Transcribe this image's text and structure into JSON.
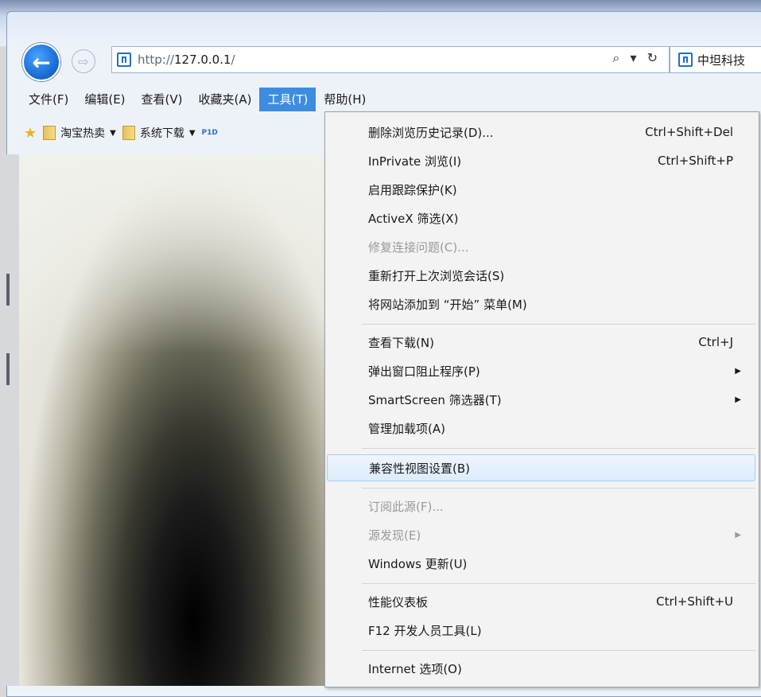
{
  "browser": {
    "address": {
      "url_prefix": "http://",
      "url_host": "127.0.0.1",
      "url_suffix": "/",
      "search_glyphs": "⌕ ▾ ↻"
    },
    "tab": {
      "title": "中坦科技"
    },
    "back_icon": "←",
    "forward_icon": "⇨"
  },
  "menubar": {
    "items": [
      {
        "label": "文件(F)"
      },
      {
        "label": "编辑(E)"
      },
      {
        "label": "查看(V)"
      },
      {
        "label": "收藏夹(A)"
      },
      {
        "label": "工具(T)"
      },
      {
        "label": "帮助(H)"
      }
    ]
  },
  "favorites": {
    "items": [
      {
        "label": "淘宝热卖"
      },
      {
        "label": "系统下载"
      }
    ],
    "pid": "P1D"
  },
  "tools_menu": {
    "items": [
      {
        "label": "删除浏览历史记录(D)...",
        "shortcut": "Ctrl+Shift+Del"
      },
      {
        "label": "InPrivate 浏览(I)",
        "shortcut": "Ctrl+Shift+P"
      },
      {
        "label": "启用跟踪保护(K)",
        "shortcut": ""
      },
      {
        "label": "ActiveX 筛选(X)",
        "shortcut": ""
      },
      {
        "label": "修复连接问题(C)...",
        "shortcut": ""
      },
      {
        "label": "重新打开上次浏览会话(S)",
        "shortcut": ""
      },
      {
        "label": "将网站添加到 “开始” 菜单(M)",
        "shortcut": ""
      },
      {
        "label": "查看下载(N)",
        "shortcut": "Ctrl+J"
      },
      {
        "label": "弹出窗口阻止程序(P)",
        "shortcut": ""
      },
      {
        "label": "SmartScreen 筛选器(T)",
        "shortcut": ""
      },
      {
        "label": "管理加载项(A)",
        "shortcut": ""
      },
      {
        "label": "兼容性视图设置(B)",
        "shortcut": ""
      },
      {
        "label": "订阅此源(F)...",
        "shortcut": ""
      },
      {
        "label": "源发现(E)",
        "shortcut": ""
      },
      {
        "label": "Windows 更新(U)",
        "shortcut": ""
      },
      {
        "label": "性能仪表板",
        "shortcut": "Ctrl+Shift+U"
      },
      {
        "label": "F12 开发人员工具(L)",
        "shortcut": ""
      },
      {
        "label": "Internet 选项(O)",
        "shortcut": ""
      }
    ],
    "submenu_arrow": "▶"
  },
  "colors": {
    "menu_active": "#3c8de0",
    "hover_item": "#dcebfc"
  }
}
